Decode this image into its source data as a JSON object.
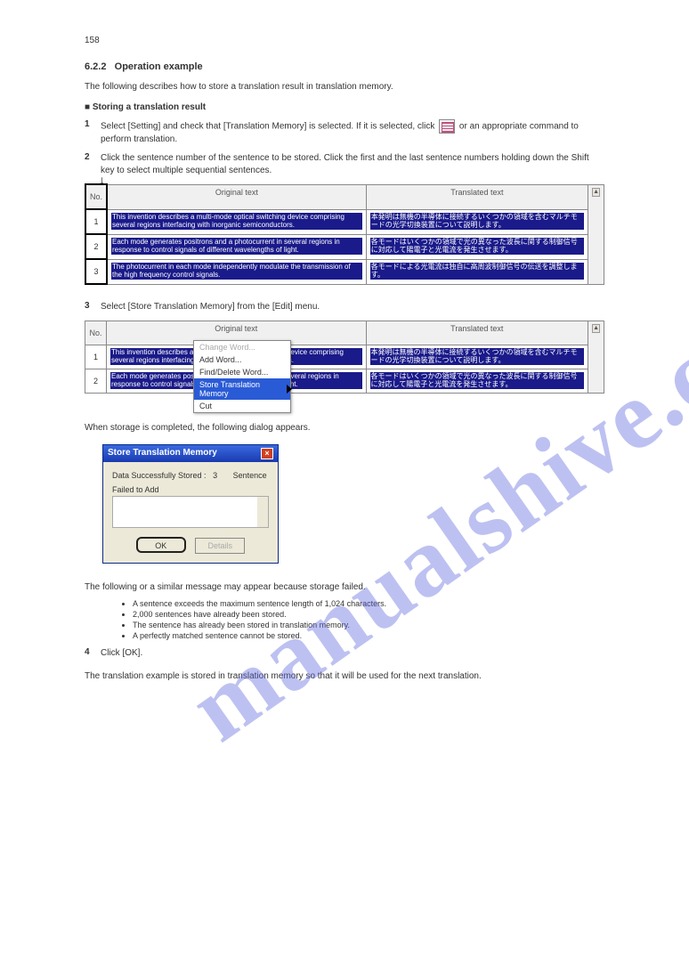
{
  "page_number": "158",
  "section": {
    "number": "6.2.2",
    "title": "Operation example"
  },
  "intro": "The following describes how to store a translation result in translation memory.",
  "subsection_a": "Storing a translation result",
  "step1": {
    "num": "1",
    "text_before": "Select [Setting] and check that [Translation Memory] is selected. If it is selected, click ",
    "text_after": " or an appropriate command to perform translation."
  },
  "step2": {
    "num": "2",
    "text": "Click the sentence number of the sentence to be stored. Click the first and the last sentence numbers holding down the Shift key to select multiple sequential sentences."
  },
  "table": {
    "headers": {
      "no": "No.",
      "orig": "Original text",
      "trans": "Translated text"
    },
    "rows": [
      {
        "no": "1",
        "orig": "This invention describes a multi-mode optical switching device comprising several regions interfacing with inorganic semiconductors.",
        "trans": "本発明は無機の半導体に接続するいくつかの領域を含むマルチモードの光学切換装置について説明します。"
      },
      {
        "no": "2",
        "orig": "Each mode generates positrons and a photocurrent in several regions in response to control signals of different wavelengths of light.",
        "trans": "各モードはいくつかの領域で光の異なった波長に関する制御信号に対応して陽電子と光電流を発生させます。"
      },
      {
        "no": "3",
        "orig": "The photocurrent in each mode independently modulate the transmission of the high frequency control signals.",
        "trans": "各モードによる光電流は独自に高周波制御信号の伝送を調整します。"
      }
    ]
  },
  "step3": {
    "num": "3",
    "text": "Select [Store Translation Memory] from the [Edit] menu."
  },
  "context_menu": {
    "change_word": "Change Word...",
    "add_word": "Add Word...",
    "find_delete": "Find/Delete Word...",
    "store_tm": "Store Translation Memory",
    "cut": "Cut"
  },
  "after_menu": "When storage is completed, the following dialog appears.",
  "dialog": {
    "title": "Store Translation Memory",
    "stored_label": "Data Successfully Stored :",
    "stored_count": "3",
    "stored_unit": "Sentence",
    "failed_label": "Failed to Add",
    "ok": "OK",
    "details": "Details"
  },
  "notes_intro": "The following or a similar message may appear because storage failed.",
  "notes": [
    "A sentence exceeds the maximum sentence length of 1,024 characters.",
    "2,000 sentences have already been stored.",
    "The sentence has already been stored in translation memory.",
    "A perfectly matched sentence cannot be stored."
  ],
  "step4": {
    "num": "4",
    "text": "Click [OK]."
  },
  "last_line": "The translation example is stored in translation memory so that it will be used for the next translation."
}
